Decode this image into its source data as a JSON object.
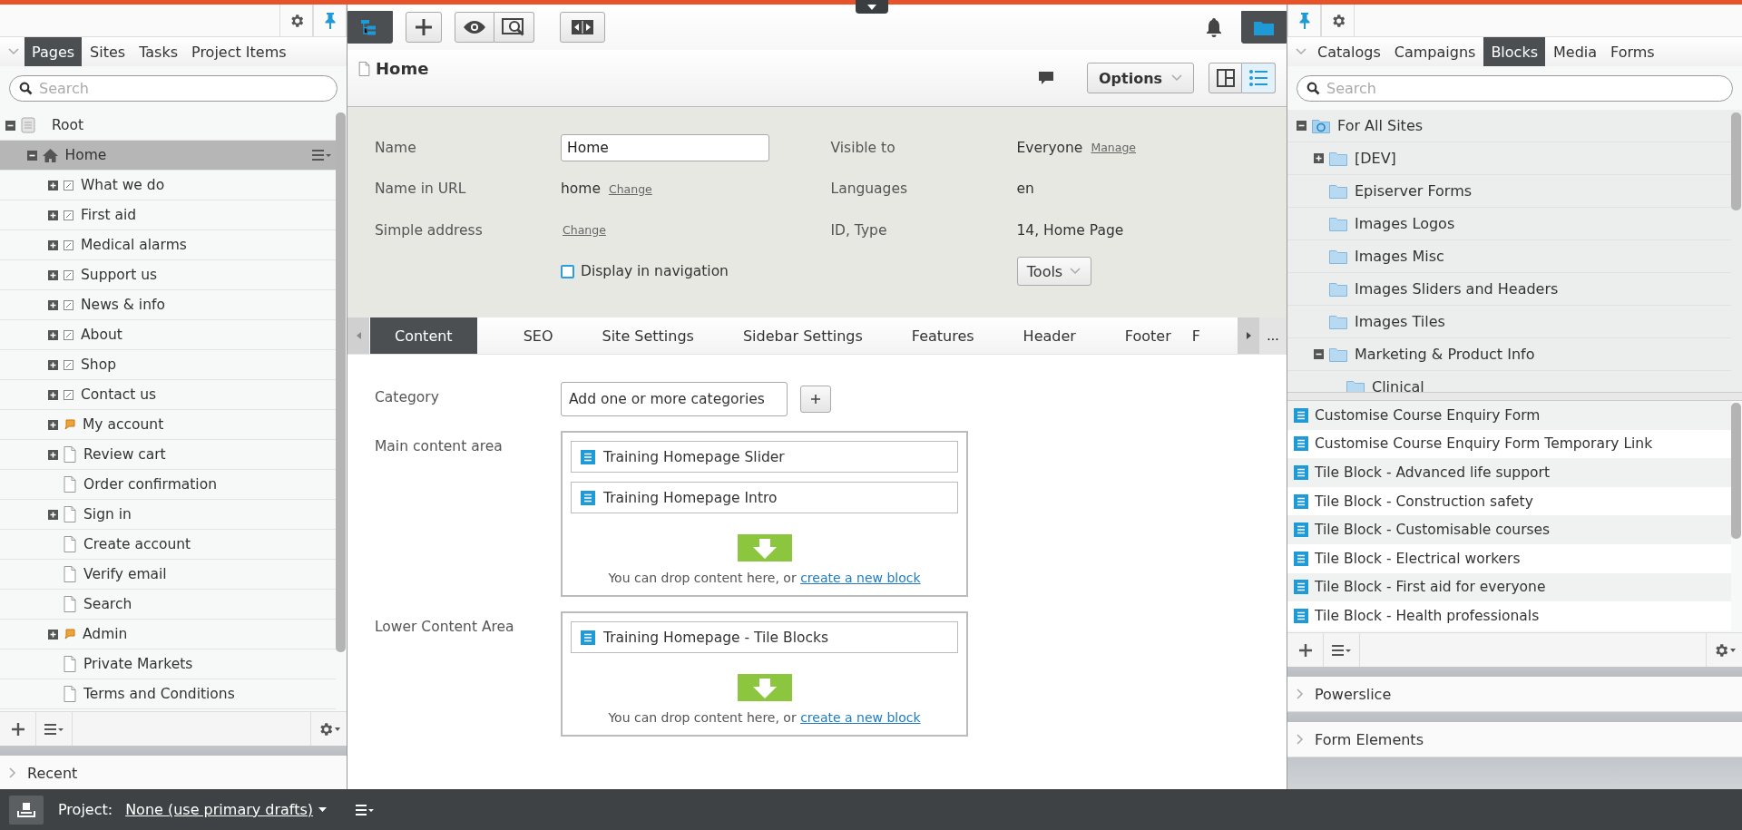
{
  "left_panel": {
    "tabs": [
      {
        "label": "Pages",
        "selected": true
      },
      {
        "label": "Sites",
        "selected": false
      },
      {
        "label": "Tasks",
        "selected": false
      },
      {
        "label": "Project Items",
        "selected": false
      }
    ],
    "search": {
      "placeholder": "Search"
    },
    "tree": [
      {
        "label": "Root",
        "kind": "root",
        "expanded": true,
        "selected": false,
        "children": [
          {
            "label": "Home",
            "kind": "home",
            "expanded": true,
            "selected": true,
            "children": [
              {
                "label": "What we do",
                "kind": "container",
                "expanded": false,
                "selected": false
              },
              {
                "label": "First aid",
                "kind": "container",
                "expanded": false,
                "selected": false
              },
              {
                "label": "Medical alarms",
                "kind": "container",
                "expanded": false,
                "selected": false
              },
              {
                "label": "Support us",
                "kind": "container",
                "expanded": false,
                "selected": false
              },
              {
                "label": "News & info",
                "kind": "container",
                "expanded": false,
                "selected": false
              },
              {
                "label": "About",
                "kind": "container",
                "expanded": false,
                "selected": false
              },
              {
                "label": "Shop",
                "kind": "container",
                "expanded": false,
                "selected": false
              },
              {
                "label": "Contact us",
                "kind": "container",
                "expanded": false,
                "selected": false
              },
              {
                "label": "My account",
                "kind": "shortcut",
                "expanded": false,
                "selected": false
              },
              {
                "label": "Review cart",
                "kind": "page",
                "expanded": false,
                "selected": false
              },
              {
                "label": "Order confirmation",
                "kind": "page",
                "selected": false
              },
              {
                "label": "Sign in",
                "kind": "page",
                "expanded": false,
                "selected": false
              },
              {
                "label": "Create account",
                "kind": "page",
                "selected": false
              },
              {
                "label": "Verify email",
                "kind": "page",
                "selected": false
              },
              {
                "label": "Search",
                "kind": "page",
                "selected": false
              },
              {
                "label": "Admin",
                "kind": "shortcut",
                "expanded": false,
                "selected": false
              },
              {
                "label": "Private Markets",
                "kind": "page",
                "selected": false
              },
              {
                "label": "Terms and Conditions",
                "kind": "page",
                "selected": false
              }
            ]
          }
        ]
      }
    ],
    "recent": "Recent"
  },
  "editor": {
    "title": "Home",
    "options": "Options",
    "properties_left": [
      {
        "kind": "input",
        "label": "Name",
        "value": "Home"
      },
      {
        "kind": "text",
        "label": "Name in URL",
        "value": "home",
        "link": "Change"
      },
      {
        "kind": "text",
        "label": "Simple address",
        "link": "Change"
      },
      {
        "kind": "checkbox",
        "text": "Display in navigation",
        "checked": false
      }
    ],
    "properties_right": [
      {
        "kind": "text",
        "label": "Visible to",
        "value": "Everyone",
        "link": "Manage"
      },
      {
        "kind": "text",
        "label": "Languages",
        "value": "en"
      },
      {
        "kind": "text",
        "label": "ID, Type",
        "value": "14, Home Page"
      },
      {
        "kind": "dropdown",
        "value": "Tools"
      }
    ],
    "tabs": [
      {
        "label": "Content",
        "selected": true
      },
      {
        "label": "SEO",
        "selected": false
      },
      {
        "label": "Site Settings",
        "selected": false
      },
      {
        "label": "Sidebar Settings",
        "selected": false
      },
      {
        "label": "Features",
        "selected": false
      },
      {
        "label": "Header",
        "selected": false
      },
      {
        "label": "Footer",
        "selected": false
      },
      {
        "label": "F",
        "selected": false
      }
    ],
    "more": "...",
    "category": {
      "label": "Category",
      "button": "Add one or more categories"
    },
    "areas": [
      {
        "label": "Main content area",
        "items": [
          "Training Homepage Slider",
          "Training Homepage Intro"
        ],
        "drop_text": "You can drop content here, or",
        "drop_link": "create a new block"
      },
      {
        "label": "Lower Content Area",
        "items": [
          "Training Homepage - Tile Blocks"
        ],
        "drop_text": "You can drop content here, or",
        "drop_link": "create a new block"
      }
    ]
  },
  "right_panel": {
    "tabs": [
      {
        "label": "Catalogs",
        "selected": false
      },
      {
        "label": "Campaigns",
        "selected": false
      },
      {
        "label": "Blocks",
        "selected": true
      },
      {
        "label": "Media",
        "selected": false
      },
      {
        "label": "Forms",
        "selected": false
      }
    ],
    "search": {
      "placeholder": "Search"
    },
    "tree": [
      {
        "label": "For All Sites",
        "kind": "global",
        "expanded": true,
        "children": [
          {
            "label": "[DEV]",
            "kind": "folder",
            "expanded": false
          },
          {
            "label": "Episerver Forms",
            "kind": "folder"
          },
          {
            "label": "Images Logos",
            "kind": "folder"
          },
          {
            "label": "Images Misc",
            "kind": "folder"
          },
          {
            "label": "Images Sliders and Headers",
            "kind": "folder"
          },
          {
            "label": "Images Tiles",
            "kind": "folder"
          },
          {
            "label": "Marketing & Product Info",
            "kind": "folder",
            "expanded": true,
            "children": [
              {
                "label": "Clinical",
                "kind": "folder"
              }
            ]
          }
        ]
      }
    ],
    "blocks": [
      "Customise Course Enquiry Form",
      "Customise Course Enquiry Form Temporary Link",
      "Tile Block - Advanced life support",
      "Tile Block - Construction safety",
      "Tile Block - Customisable courses",
      "Tile Block - Electrical workers",
      "Tile Block - First aid for everyone",
      "Tile Block - Health professionals"
    ],
    "gadgets": [
      "Powerslice",
      "Form Elements"
    ]
  },
  "status_bar": {
    "label": "Project:",
    "project": "None (use primary drafts)"
  }
}
